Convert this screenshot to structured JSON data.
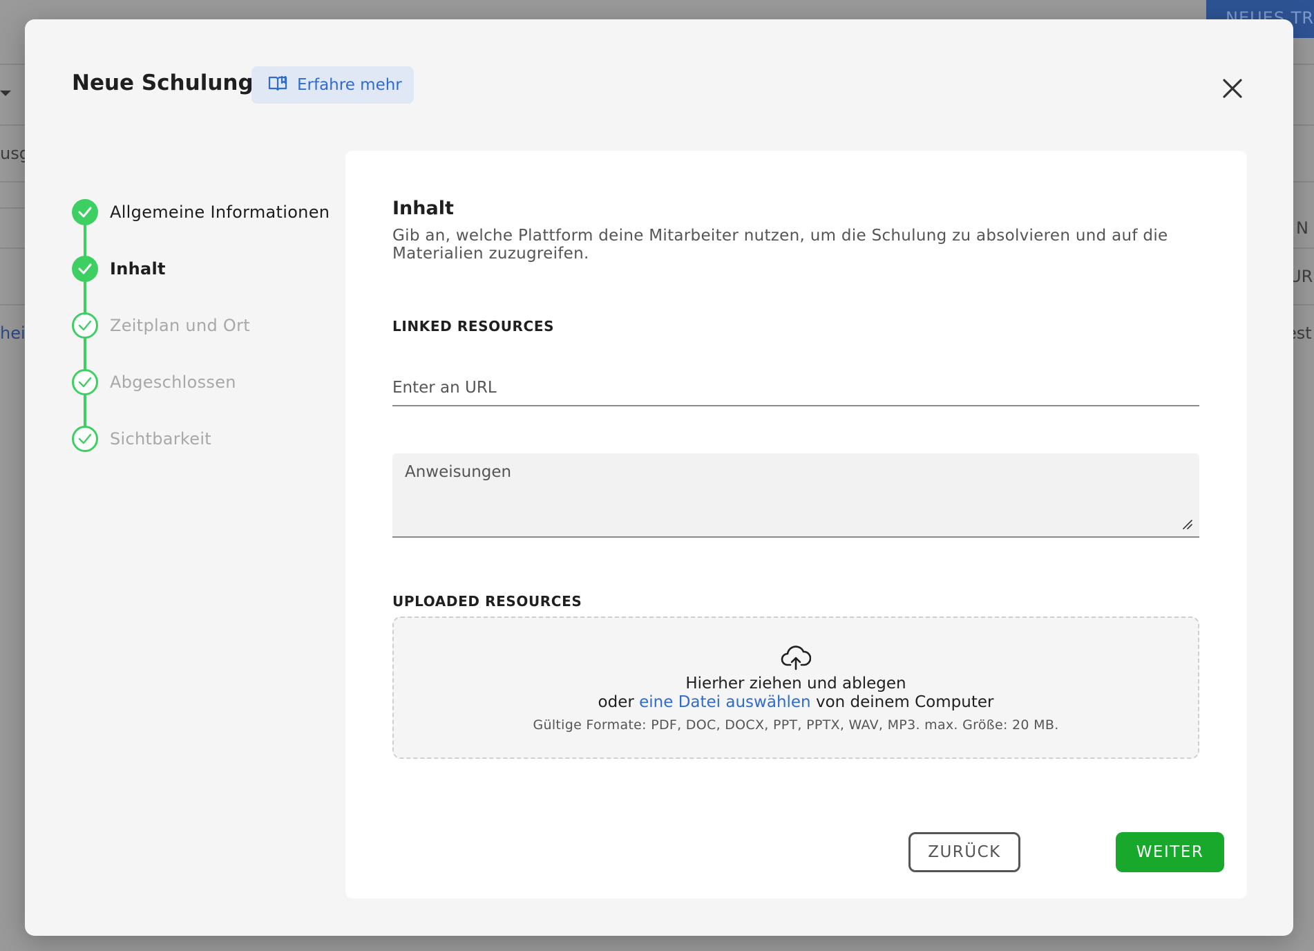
{
  "background": {
    "button_label": "NEUES TR",
    "fragments": [
      "usge",
      "heit",
      "N",
      "UR",
      "est"
    ]
  },
  "modal": {
    "title": "Neue Schulung",
    "learn_more_label": "Erfahre mehr",
    "close_icon": "close-icon",
    "learn_icon": "book-icon"
  },
  "stepper": {
    "steps": [
      {
        "label": "Allgemeine Informationen",
        "state": "done"
      },
      {
        "label": "Inhalt",
        "state": "active"
      },
      {
        "label": "Zeitplan und Ort",
        "state": "todo"
      },
      {
        "label": "Abgeschlossen",
        "state": "todo"
      },
      {
        "label": "Sichtbarkeit",
        "state": "todo"
      }
    ],
    "done_color": "#3ecf63"
  },
  "content": {
    "title": "Inhalt",
    "description": "Gib an, welche Plattform deine Mitarbeiter nutzen, um die Schulung zu absolvieren und auf die Materialien zuzugreifen.",
    "linked_resources_label": "LINKED RESOURCES",
    "url_placeholder": "Enter an URL",
    "instructions_placeholder": "Anweisungen",
    "uploaded_resources_label": "UPLOADED RESOURCES",
    "dropzone": {
      "icon": "cloud-upload-icon",
      "line1": "Hierher ziehen und ablegen",
      "line2_prefix": "oder ",
      "line2_link": "eine Datei auswählen",
      "line2_suffix": " von deinem Computer",
      "formats": "Gültige Formate: PDF, DOC, DOCX, PPT, PPTX, WAV, MP3. max. Größe: 20 MB."
    }
  },
  "footer": {
    "back_label": "ZURÜCK",
    "next_label": "WEITER",
    "next_color": "#17a82c"
  }
}
